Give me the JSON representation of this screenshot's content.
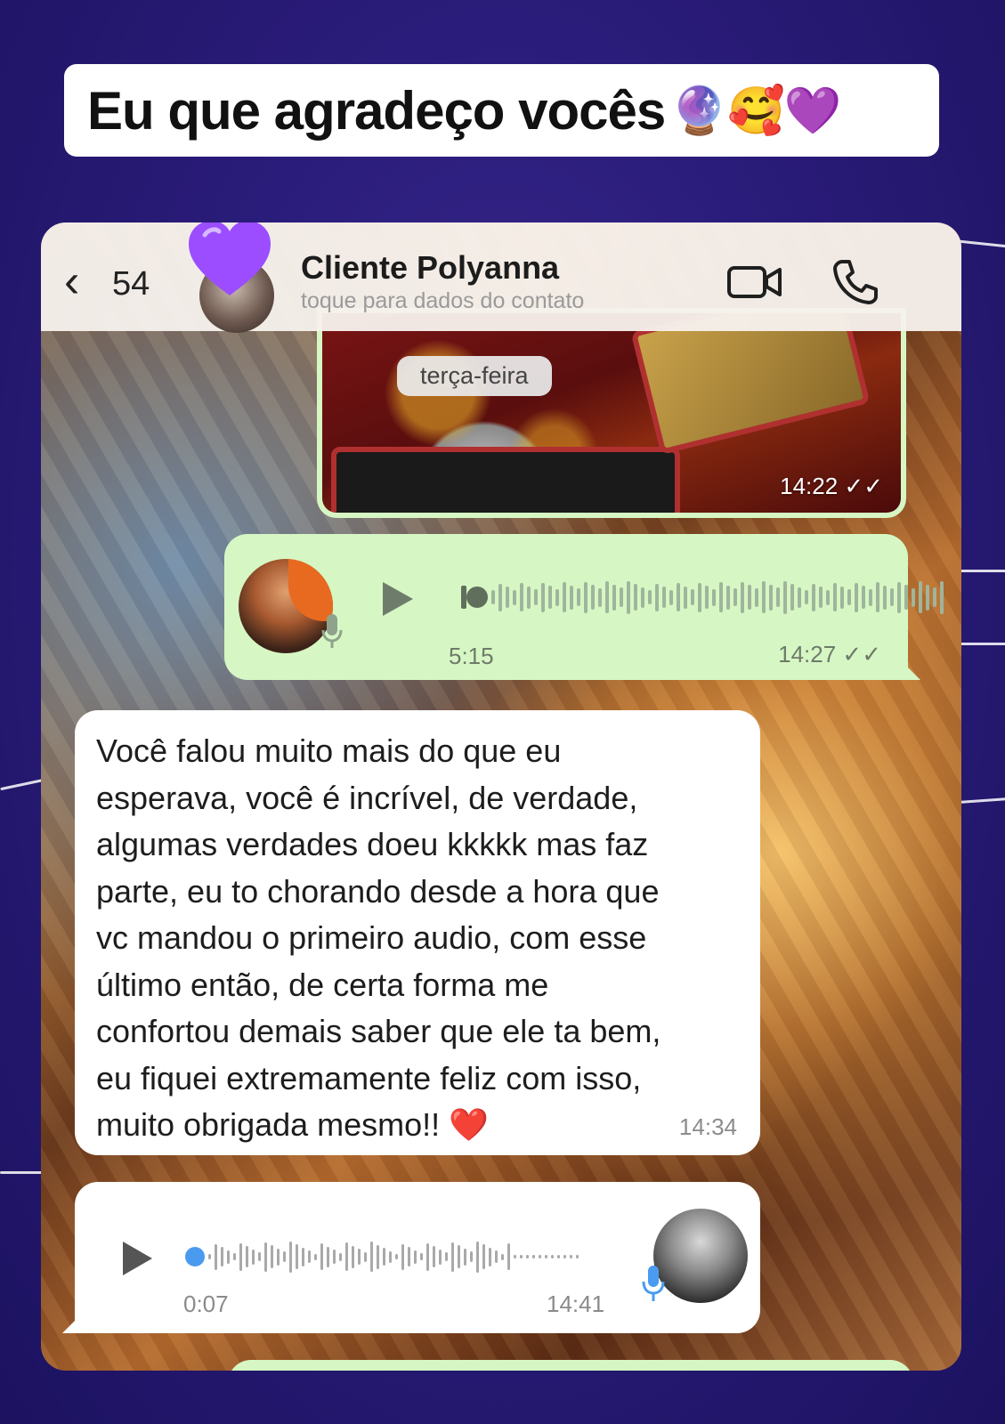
{
  "caption": {
    "text": "Eu que agradeço vocês",
    "emojis": "🔮🥰💜"
  },
  "header": {
    "back_count": "54",
    "contact_name": "Cliente Polyanna",
    "contact_subtitle": "toque para dados do contato"
  },
  "chat": {
    "date_separator": "terça-feira",
    "image_message": {
      "time": "14:22",
      "status": "read"
    },
    "outgoing_audio": {
      "duration": "5:15",
      "time": "14:27",
      "status": "read"
    },
    "incoming_text": {
      "text": "Você falou muito mais do que eu\nesperava, você é incrível, de verdade,\nalgumas verdades doeu kkkkk mas faz\nparte, eu to chorando desde a hora que\nvc mandou o primeiro audio, com esse\núltimo então, de certa forma me\nconfortou demais saber que ele ta bem,\neu fiquei extremamente feliz com isso,\nmuito obrigada mesmo!! ❤️",
      "time": "14:34"
    },
    "incoming_audio": {
      "duration": "0:07",
      "time": "14:41"
    }
  },
  "colors": {
    "background": "#2a1c7a",
    "outgoing_bubble": "#d6f7c4",
    "incoming_bubble": "#ffffff",
    "heart": "#9b4dff",
    "audio_played_dot": "#4a9bf0"
  }
}
